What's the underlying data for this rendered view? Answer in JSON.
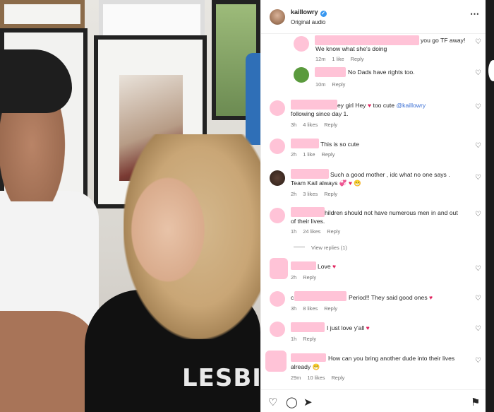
{
  "header": {
    "username": "kaillowry",
    "verified_mark": "✓",
    "subtitle": "Original audio",
    "more_icon": "⋯"
  },
  "media": {
    "shirt_text": "LESBIAN"
  },
  "comments": [
    {
      "text": "you go TF away! We know what she's doing",
      "time": "12m",
      "likes": "1 like",
      "reply": "Reply"
    },
    {
      "text": "No Dads have rights too.",
      "time": "10m",
      "reply": "Reply"
    },
    {
      "text_pre": "ey girl Hey ",
      "text_mid": " too cute ",
      "mention": "@kaillowry",
      "text_post": " Been following since day 1.",
      "time": "3h",
      "likes": "4 likes",
      "reply": "Reply"
    },
    {
      "text": "This is so cute",
      "time": "2h",
      "likes": "1 like",
      "reply": "Reply"
    },
    {
      "text": "Such a good mother , idc what no one says . Team Kail always ",
      "time": "2h",
      "likes": "3 likes",
      "reply": "Reply"
    },
    {
      "text": "hildren should not have numerous men in and out of their lives.",
      "time": "1h",
      "likes": "24 likes",
      "reply": "Reply",
      "view_replies": "View replies (1)"
    },
    {
      "text": "Love ",
      "time": "2h",
      "reply": "Reply"
    },
    {
      "text_pre": "c",
      "text": "Period!! They said good ones ",
      "time": "3h",
      "likes": "8 likes",
      "reply": "Reply"
    },
    {
      "text": "I just love y'all ",
      "time": "1h",
      "reply": "Reply"
    },
    {
      "text": "How can you bring another dude into their lives already ",
      "time": "29m",
      "likes": "10 likes",
      "reply": "Reply"
    }
  ],
  "emoji": {
    "heart": "♥",
    "sparkle_hearts": "💞",
    "grin": "😁",
    "heart_outline": "♡"
  },
  "footer": {
    "like_icon": "♡",
    "comment_icon": "◯",
    "share_icon": "➤",
    "save_icon": "⚑"
  }
}
